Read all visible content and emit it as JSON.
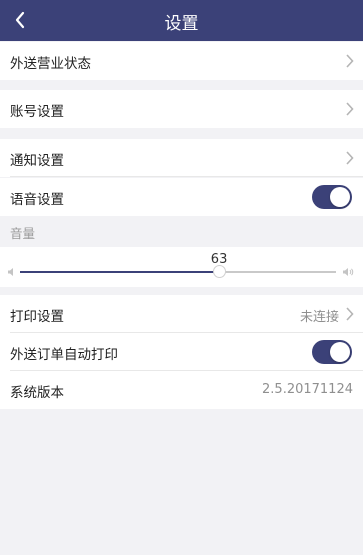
{
  "header": {
    "title": "设置"
  },
  "rows": {
    "delivery_status": {
      "label": "外送营业状态"
    },
    "account": {
      "label": "账号设置"
    },
    "notification": {
      "label": "通知设置"
    },
    "voice": {
      "label": "语音设置",
      "enabled": true
    },
    "print": {
      "label": "打印设置",
      "value": "未连接"
    },
    "auto_print": {
      "label": "外送订单自动打印",
      "enabled": true
    },
    "version": {
      "label": "系统版本",
      "value": "2.5.20171124"
    }
  },
  "volume": {
    "caption": "音量",
    "value": "63",
    "level": 0.63
  },
  "colors": {
    "accent": "#3b4178",
    "background": "#f2f2f5"
  },
  "icons": [
    "back-icon",
    "chevron-right-icon",
    "volume-low-icon",
    "volume-high-icon"
  ]
}
